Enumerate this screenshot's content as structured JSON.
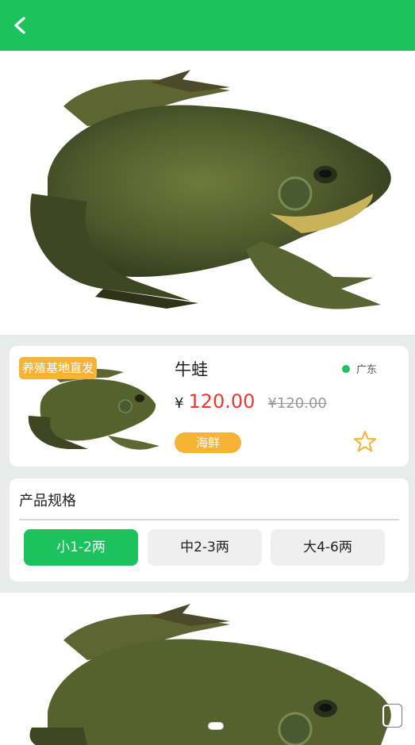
{
  "colors": {
    "brand": "#1cc25e",
    "tag": "#f6b336",
    "price": "#e53935"
  },
  "product": {
    "origin_tag": "养殖基地直发",
    "name": "牛蛙",
    "region": "广东",
    "currency": "¥",
    "price": "120.00",
    "old_price": "¥120.00",
    "category": "海鲜"
  },
  "specs": {
    "title": "产品规格",
    "options": [
      {
        "label": "小1-2两",
        "selected": true
      },
      {
        "label": "中2-3两",
        "selected": false
      },
      {
        "label": "大4-6两",
        "selected": false
      }
    ]
  },
  "icons": {
    "back": "chevron-left-icon",
    "favorite": "star-outline-icon",
    "corner": "floating-window-icon"
  }
}
